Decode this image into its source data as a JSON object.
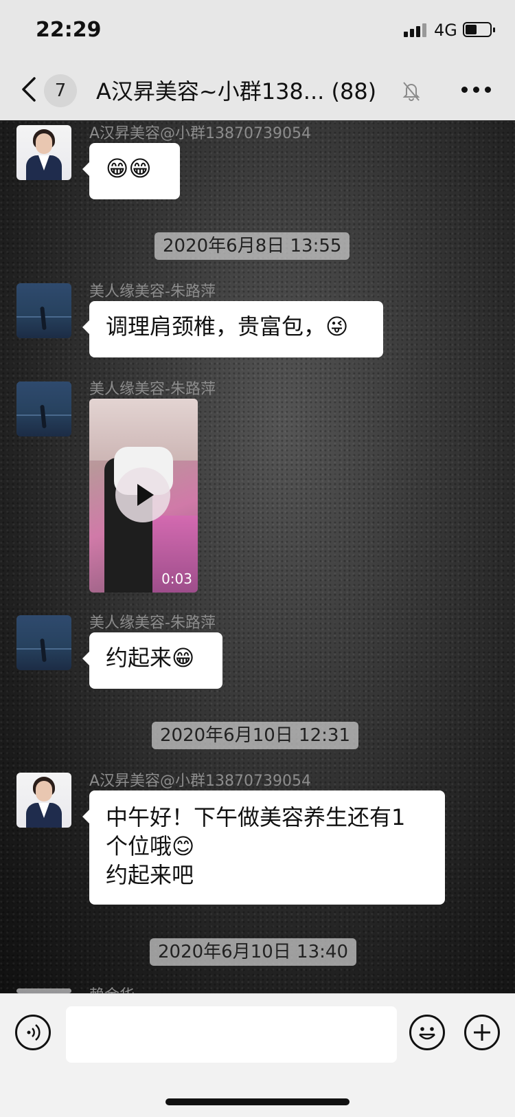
{
  "status_bar": {
    "time": "22:29",
    "network": "4G"
  },
  "nav": {
    "unread_count": "7",
    "title": "A汉昇美容~小群138...  (88)"
  },
  "messages": [
    {
      "type": "text",
      "sender": "A汉昇美容@小群13870739054",
      "text": "😁😁"
    },
    {
      "type": "timestamp",
      "text": "2020年6月8日 13:55"
    },
    {
      "type": "text",
      "sender": "美人缘美容-朱路萍",
      "text": "调理肩颈椎，贵富包，😜"
    },
    {
      "type": "video",
      "sender": "美人缘美容-朱路萍",
      "duration": "0:03"
    },
    {
      "type": "text",
      "sender": "美人缘美容-朱路萍",
      "text": "约起来😁"
    },
    {
      "type": "timestamp",
      "text": "2020年6月10日 12:31"
    },
    {
      "type": "text",
      "sender": "A汉昇美容@小群13870739054",
      "lines": [
        "中午好！下午做美容养生还有1",
        "个位哦😊",
        "约起来吧"
      ]
    },
    {
      "type": "timestamp",
      "text": "2020年6月10日 13:40"
    },
    {
      "type": "partial",
      "sender": "赖金华"
    }
  ],
  "input": {
    "placeholder": ""
  },
  "icons": {
    "back": "chevron-left-icon",
    "mute": "bell-slash-icon",
    "more": "more-dots-icon",
    "voice": "voice-icon",
    "emoji": "smiley-icon",
    "plus": "plus-icon"
  }
}
